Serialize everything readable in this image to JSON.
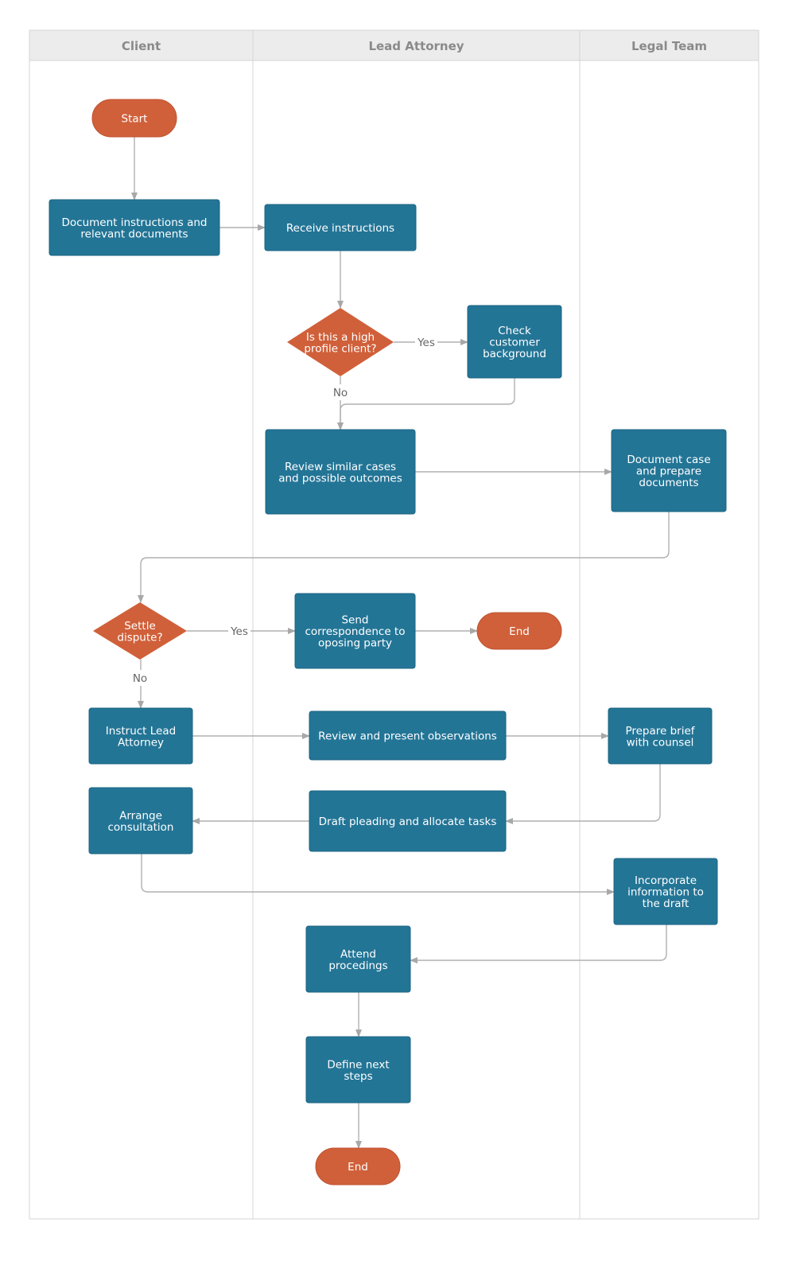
{
  "colors": {
    "process": "#237596",
    "terminal": "#D0603A",
    "decision": "#D0603A",
    "connector": "#b0b0b0",
    "header": "#ececec",
    "lane_border": "#d6d6d6"
  },
  "lanes": [
    {
      "id": "client",
      "title": "Client"
    },
    {
      "id": "lead",
      "title": "Lead Attorney"
    },
    {
      "id": "legal",
      "title": "Legal Team"
    }
  ],
  "nodes": [
    {
      "id": "start",
      "type": "terminal",
      "lane": "client",
      "lines": [
        "Start"
      ]
    },
    {
      "id": "doc_instr",
      "type": "process",
      "lane": "client",
      "lines": [
        "Document instructions and",
        "relevant documents"
      ]
    },
    {
      "id": "receive",
      "type": "process",
      "lane": "lead",
      "lines": [
        "Receive instructions"
      ]
    },
    {
      "id": "dec1",
      "type": "decision",
      "lane": "lead",
      "lines": [
        "Is this a high",
        "profile client?"
      ]
    },
    {
      "id": "check",
      "type": "process",
      "lane": "lead",
      "lines": [
        "Check",
        "customer",
        "background"
      ]
    },
    {
      "id": "review",
      "type": "process",
      "lane": "lead",
      "lines": [
        "Review similar cases",
        "and possible outcomes"
      ]
    },
    {
      "id": "doc_case",
      "type": "process",
      "lane": "legal",
      "lines": [
        "Document case",
        "and prepare",
        "documents"
      ]
    },
    {
      "id": "dec2",
      "type": "decision",
      "lane": "client",
      "lines": [
        "Settle",
        "dispute?"
      ]
    },
    {
      "id": "send",
      "type": "process",
      "lane": "lead",
      "lines": [
        "Send",
        "correspondence to",
        "oposing party"
      ]
    },
    {
      "id": "end1",
      "type": "terminal",
      "lane": "lead",
      "lines": [
        "End"
      ]
    },
    {
      "id": "instruct",
      "type": "process",
      "lane": "client",
      "lines": [
        "Instruct Lead",
        "Attorney"
      ]
    },
    {
      "id": "review_obs",
      "type": "process",
      "lane": "lead",
      "lines": [
        "Review and present observations"
      ]
    },
    {
      "id": "prepare",
      "type": "process",
      "lane": "legal",
      "lines": [
        "Prepare brief",
        "with counsel"
      ]
    },
    {
      "id": "arrange",
      "type": "process",
      "lane": "client",
      "lines": [
        "Arrange",
        "consultation"
      ]
    },
    {
      "id": "draft",
      "type": "process",
      "lane": "lead",
      "lines": [
        "Draft pleading and allocate tasks"
      ]
    },
    {
      "id": "incorporate",
      "type": "process",
      "lane": "legal",
      "lines": [
        "Incorporate",
        "information to",
        "the draft"
      ]
    },
    {
      "id": "attend",
      "type": "process",
      "lane": "lead",
      "lines": [
        "Attend",
        "procedings"
      ]
    },
    {
      "id": "define",
      "type": "process",
      "lane": "lead",
      "lines": [
        "Define next",
        "steps"
      ]
    },
    {
      "id": "end2",
      "type": "terminal",
      "lane": "lead",
      "lines": [
        "End"
      ]
    }
  ],
  "edges": [
    {
      "from": "start",
      "to": "doc_instr",
      "label": ""
    },
    {
      "from": "doc_instr",
      "to": "receive",
      "label": ""
    },
    {
      "from": "receive",
      "to": "dec1",
      "label": ""
    },
    {
      "from": "dec1",
      "to": "check",
      "label": "Yes"
    },
    {
      "from": "dec1",
      "to": "review",
      "label": "No"
    },
    {
      "from": "check",
      "to": "review",
      "label": ""
    },
    {
      "from": "review",
      "to": "doc_case",
      "label": ""
    },
    {
      "from": "doc_case",
      "to": "dec2",
      "label": ""
    },
    {
      "from": "dec2",
      "to": "send",
      "label": "Yes"
    },
    {
      "from": "send",
      "to": "end1",
      "label": ""
    },
    {
      "from": "dec2",
      "to": "instruct",
      "label": "No"
    },
    {
      "from": "instruct",
      "to": "review_obs",
      "label": ""
    },
    {
      "from": "review_obs",
      "to": "prepare",
      "label": ""
    },
    {
      "from": "prepare",
      "to": "draft",
      "label": ""
    },
    {
      "from": "draft",
      "to": "arrange",
      "label": ""
    },
    {
      "from": "arrange",
      "to": "incorporate",
      "label": ""
    },
    {
      "from": "incorporate",
      "to": "attend",
      "label": ""
    },
    {
      "from": "attend",
      "to": "define",
      "label": ""
    },
    {
      "from": "define",
      "to": "end2",
      "label": ""
    }
  ]
}
